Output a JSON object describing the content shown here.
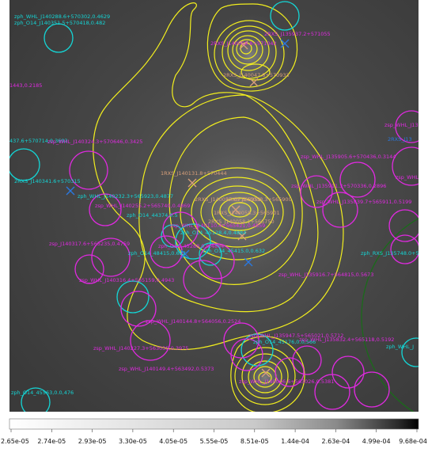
{
  "colorbar": {
    "ticks": [
      "2.65e-05",
      "2.74e-05",
      "2.93e-05",
      "3.30e-05",
      "4.05e-05",
      "5.55e-05",
      "8.51e-05",
      "1.44e-04",
      "2.63e-04",
      "4.99e-04",
      "9.68e-04"
    ]
  },
  "colors": {
    "contour": "#f2ee1e",
    "zph": "#14d6d6",
    "zsp": "#e02ae0",
    "rxs": "#2a78e0",
    "xmm": "#d9a07a",
    "wide_circle": "#1a6b1a"
  },
  "labels": {
    "top_left_1": "zph_WHL_J140288.6+570302,0.4629",
    "top_left_2": "zph_O14_J140351.5+570418,0.482",
    "top_left_3": "1443,0.2185",
    "left_1": "437.6+570714,0.3603",
    "left_2": "zsp_WHL_J140324.3+570646,0.3425",
    "left_3": "2RXS_J140341.6+570315",
    "center_1": "zph_WHL_J140232.3+565923,0.4877",
    "center_2": "zsp_WHL_J140255.2+565740,0.4869",
    "center_3": "zph_O14_44374,0.5",
    "center_4": "zph_O14_45128.4,0.4884",
    "center_5": "zsp_WHL_J140110.4+565421,0.4859",
    "center_6": "2RXS_J140057.6+565951",
    "center_7": "2RXS_J140058.3+565900",
    "center_8": "1RXS_J140058.3+565901",
    "center_9": "2RXS_J140058.1+565750",
    "center_10": "1RXS_J140131.8+570444",
    "center_11": "zph_O14_45288.0.0,4884",
    "center_12": "zph_O14_45415.0,0.632",
    "center_13": "zph_O14_48415,0.632",
    "lower_1": "zsp_J140317.6+565235,0.4759",
    "lower_2": "zsp_WHL_J140316.4+565159,0.4943",
    "lower_3": "zsp_WHL_J140144.8+564056,0.2524",
    "lower_4": "zsp_WHL_J140227.3+563035,0.3975",
    "lower_5": "zsp_WHL_J140149.4+563492,0.5373",
    "lower_6": "zsp_WHL_J135947.5+565021,0.5712",
    "lower_7": "zph_O14_45176,0.0,566",
    "lower_8": "zsp_WHL_J135916.7+564815,0.5673",
    "lower_9": "zsp_WHL_J140006.6+563026,0.5381",
    "lower_10": "zph_O14_45563,0.0,476",
    "right_1": "zsp_WHL_J135905.6+570436,0.3144",
    "right_2": "zsp_WHL_J135911.3+570336,0.2896",
    "right_3": "zsp_WHL_J135839.7+565911,0.5199",
    "right_4": "zph_RXS_J135748.0+5",
    "right_5": "zsp_WHL_J135832.4+565118,0.5192",
    "right_6": "zph_WHL_J",
    "right_7": "zsp_WHL_J13",
    "right_8": "2RXS_J13",
    "right_9": "zsp_WHL_J135",
    "top_1": "2RXS_J140058.8+571042",
    "top_2": "2RXS_J135937.2+571055",
    "top_3": "2RXS_J140047.8+570933",
    "bottom_right_1": "zsp_WHL_J135911.3+553959"
  }
}
